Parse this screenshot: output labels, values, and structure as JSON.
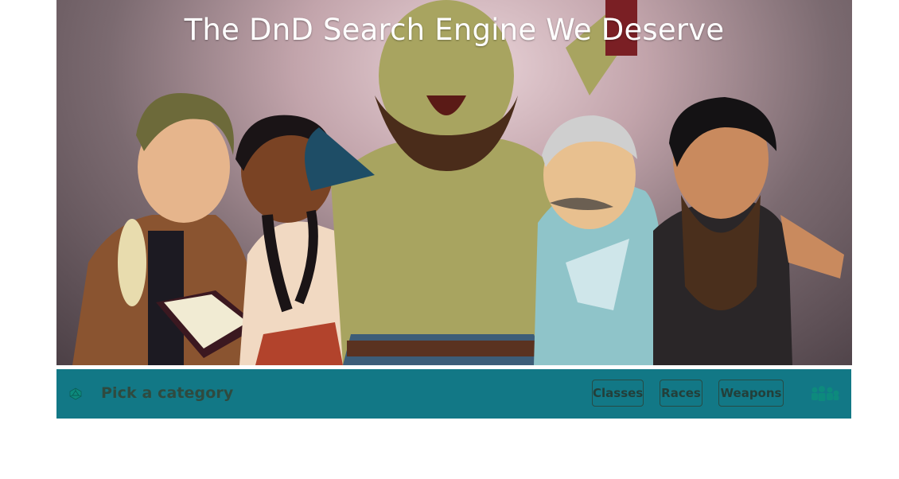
{
  "hero": {
    "title": "The DnD Search Engine We Deserve",
    "image_alt": "Illustration of a group of fantasy adventurers posing together"
  },
  "navbar": {
    "brand_icon": "d20-icon",
    "brand_label": "Pick a category",
    "buttons": [
      {
        "label": "Classes"
      },
      {
        "label": "Races"
      },
      {
        "label": "Weapons"
      }
    ],
    "party_icon": "party-icon"
  },
  "colors": {
    "navbar_bg": "#127886",
    "nav_text": "#233f3a",
    "title_text": "#ffffff"
  }
}
